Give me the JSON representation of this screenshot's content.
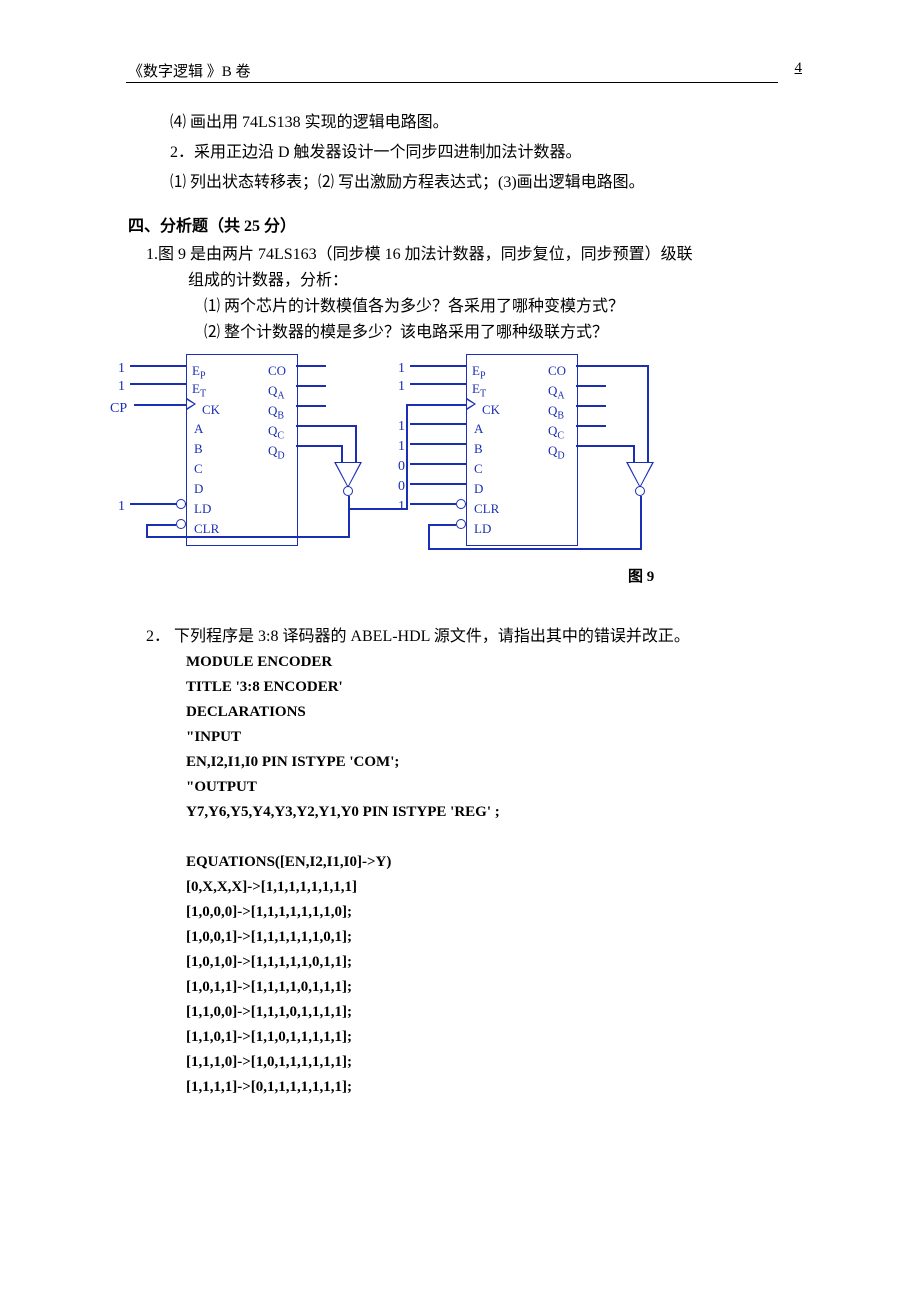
{
  "header": {
    "title": "《数字逻辑 》B 卷",
    "page": "4"
  },
  "items": {
    "i4": "⑷ 画出用 74LS138 实现的逻辑电路图。",
    "i2n": "2．采用正边沿 D 触发器设计一个同步四进制加法计数器。",
    "i2s": "⑴ 列出状态转移表；⑵ 写出激励方程表达式；(3)画出逻辑电路图。"
  },
  "section4": {
    "title": "四、分析题（共 25 分）"
  },
  "q1": {
    "line1": "1.图 9 是由两片 74LS163（同步模 16 加法计数器，同步复位，同步预置）级联",
    "line2": "组成的计数器，分析：",
    "sub1": "⑴ 两个芯片的计数模值各为多少？各采用了哪种变模方式？",
    "sub2": "⑵ 整个计数器的模是多少？该电路采用了哪种级联方式？"
  },
  "chart_data": {
    "type": "table",
    "title": "两片74LS163级联计数器图9",
    "chips": [
      {
        "name": "74LS163-left",
        "inputs_left": {
          "EP": "1",
          "ET": "1",
          "CK": "CP",
          "A": "",
          "B": "",
          "C": "",
          "D": "",
          "LD": "1",
          "CLR": "(from NAND)"
        },
        "outputs_right": [
          "CO",
          "QA",
          "QB",
          "QC",
          "QD"
        ]
      },
      {
        "name": "74LS163-right",
        "inputs_left": {
          "EP": "1",
          "ET": "1",
          "CK": "CP",
          "A": "1",
          "B": "1",
          "C": "0",
          "D": "0",
          "CLR": "1",
          "LD": "(from NAND)"
        },
        "outputs_right": [
          "CO",
          "QA",
          "QB",
          "QC",
          "QD"
        ]
      }
    ],
    "gates": [
      {
        "type": "NAND-inverter",
        "inputs": [
          "QD(left)",
          "QC(left)"
        ],
        "output": "CLR(left) & CK(right)"
      },
      {
        "type": "NAND-inverter",
        "inputs": [
          "QD(right)",
          "CO(right)"
        ],
        "output": "LD(right)"
      }
    ],
    "figure_label": "图 9"
  },
  "sig": {
    "one": "1",
    "cp": "CP",
    "zero": "0",
    "ep": "E",
    "et": "E",
    "ck": "CK",
    "a": "A",
    "b": "B",
    "c": "C",
    "d": "D",
    "ld": "LD",
    "clr": "CLR",
    "co": "CO",
    "qa": "Q",
    "qb": "Q",
    "qc": "Q",
    "qd": "Q",
    "subP": "P",
    "subT": "T",
    "subA": "A",
    "subB": "B",
    "subC": "C",
    "subD": "D"
  },
  "figlabel": "图 9",
  "q2": {
    "intro": "2． 下列程序是 3:8 译码器的 ABEL-HDL 源文件，请指出其中的错误并改正。",
    "lines": [
      "MODULE    ENCODER",
      "TITLE '3:8 ENCODER'",
      "DECLARATIONS",
      "\"INPUT",
      "EN,I2,I1,I0    PIN    ISTYPE    'COM';",
      "\"OUTPUT",
      "Y7,Y6,Y5,Y4,Y3,Y2,Y1,Y0    PIN    ISTYPE    'REG' ;",
      "",
      "EQUATIONS([EN,I2,I1,I0]->Y)",
      "[0,X,X,X]->[1,1,1,1,1,1,1,1]",
      "[1,0,0,0]->[1,1,1,1,1,1,1,0];",
      "[1,0,0,1]->[1,1,1,1,1,1,0,1];",
      "[1,0,1,0]->[1,1,1,1,1,0,1,1];",
      "[1,0,1,1]->[1,1,1,1,0,1,1,1];",
      "[1,1,0,0]->[1,1,1,0,1,1,1,1];",
      "[1,1,0,1]->[1,1,0,1,1,1,1,1];",
      "[1,1,1,0]->[1,0,1,1,1,1,1,1];",
      "[1,1,1,1]->[0,1,1,1,1,1,1,1];"
    ]
  }
}
